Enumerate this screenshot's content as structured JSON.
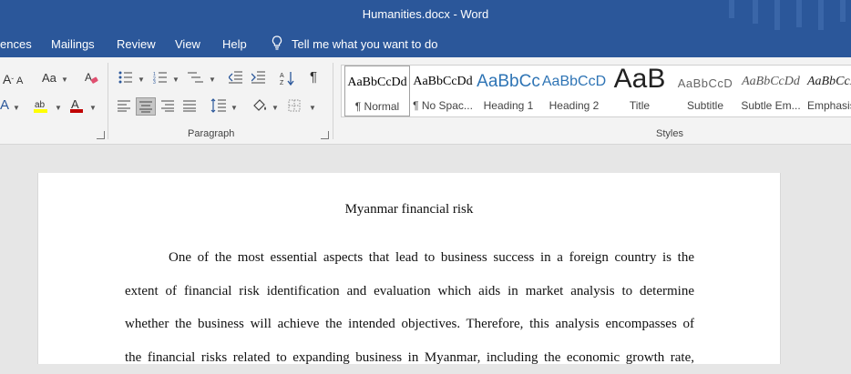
{
  "window": {
    "title": "Humanities.docx  -  Word"
  },
  "tabs": [
    "ences",
    "Mailings",
    "Review",
    "View",
    "Help"
  ],
  "tell_me": "Tell me what you want to do",
  "ribbon": {
    "paragraph_label": "Paragraph",
    "styles_label": "Styles",
    "styles": [
      {
        "preview": "AaBbCcDd",
        "label": "¶ Normal"
      },
      {
        "preview": "AaBbCcDd",
        "label": "¶ No Spac..."
      },
      {
        "preview": "AaBbCc",
        "label": "Heading 1"
      },
      {
        "preview": "AaBbCcD",
        "label": "Heading 2"
      },
      {
        "preview": "AaB",
        "label": "Title"
      },
      {
        "preview": "AaBbCcD",
        "label": "Subtitle"
      },
      {
        "preview": "AaBbCcDd",
        "label": "Subtle Em..."
      },
      {
        "preview": "AaBbCcDd",
        "label": "Emphasis"
      }
    ],
    "font_color": "#c00000",
    "highlight_color": "#ffff00"
  },
  "document": {
    "title": "Myanmar financial risk",
    "lines": [
      "One of the most essential aspects that lead to business success in a foreign country is the",
      "extent of financial risk identification and evaluation which aids in market analysis to determine",
      "whether the business will achieve the intended objectives. Therefore, this analysis encompasses of",
      "the financial risks related to expanding business in Myanmar, including the economic growth rate,"
    ]
  }
}
